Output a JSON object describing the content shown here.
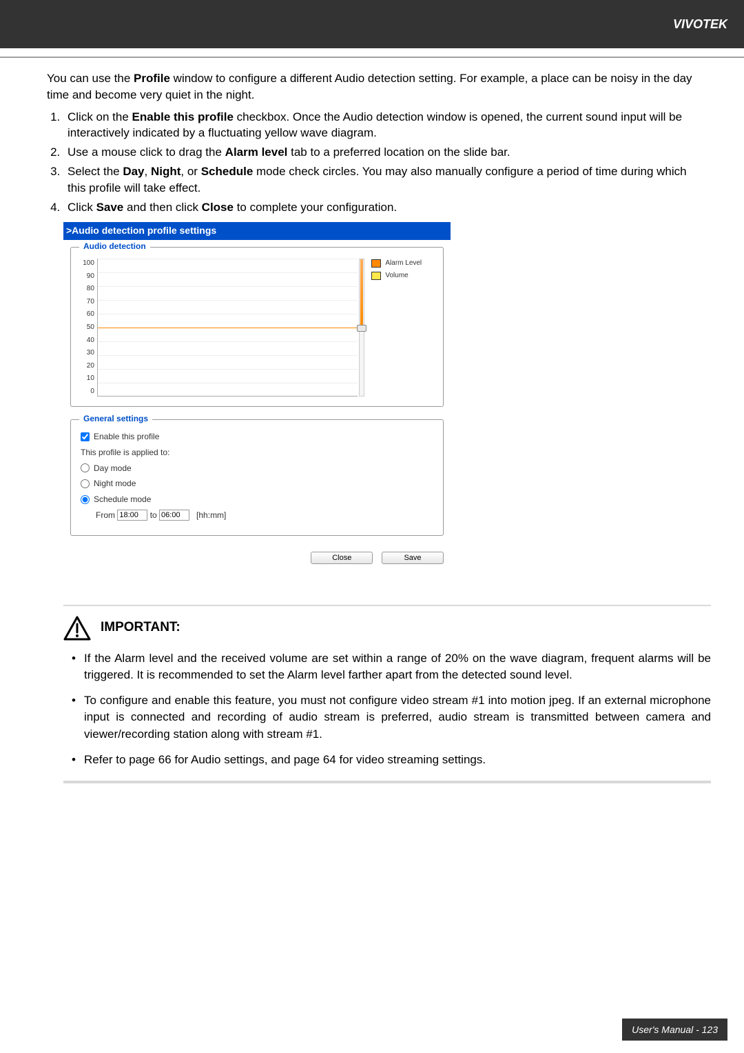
{
  "brand": "VIVOTEK",
  "intro": {
    "p1_a": "You can use the ",
    "p1_b": "Profile",
    "p1_c": " window to configure a different Audio detection setting. For example, a place can be noisy in the day time and become very quiet in the night."
  },
  "steps": [
    {
      "pre": "Click on the ",
      "bold": "Enable this profile",
      "post": " checkbox. Once the Audio detection window is opened, the current sound input will be interactively indicated by a fluctuating yellow wave diagram."
    },
    {
      "pre": "Use a mouse click to drag the ",
      "bold": "Alarm level",
      "post": " tab to a preferred location on the slide bar."
    },
    {
      "pre": "Select the ",
      "bold": "Day",
      "mid1": ", ",
      "bold2": "Night",
      "mid2": ", or ",
      "bold3": "Schedule",
      "post": " mode check circles. You may also manually configure a period of time during which this profile will take effect."
    },
    {
      "pre": "Click ",
      "bold": "Save",
      "mid1": " and then click ",
      "bold2": "Close",
      "post": " to complete your configuration."
    }
  ],
  "panel": {
    "titlebar": ">Audio detection profile settings",
    "legend_audio": "Audio detection",
    "legend_general": "General settings",
    "enable_profile": "Enable this profile",
    "applied_to": "This profile is applied to:",
    "day_mode": "Day mode",
    "night_mode": "Night mode",
    "schedule_mode": "Schedule mode",
    "from_label": "From",
    "to_label": "to",
    "from_value": "18:00",
    "to_value": "06:00",
    "time_unit": "[hh:mm]",
    "close_btn": "Close",
    "save_btn": "Save",
    "legend_alarm": "Alarm Level",
    "legend_volume": "Volume"
  },
  "chart_data": {
    "type": "line",
    "title": "",
    "xlabel": "",
    "ylabel": "",
    "ylim": [
      0,
      100
    ],
    "yticks": [
      100,
      90,
      80,
      70,
      60,
      50,
      40,
      30,
      20,
      10,
      0
    ],
    "series": [
      {
        "name": "Alarm Level",
        "values": [
          50
        ]
      },
      {
        "name": "Volume",
        "values": []
      }
    ]
  },
  "important": {
    "heading": "IMPORTANT:",
    "items": [
      "If the Alarm level and the received volume are set within a range of 20% on the wave diagram, frequent alarms will be triggered. It is recommended to set the Alarm level farther apart from the detected sound level.",
      "To configure and enable this feature, you must not configure video stream #1 into motion jpeg. If an external microphone input is connected and recording of audio stream is preferred, audio stream is transmitted between camera and viewer/recording station along with stream #1.",
      "Refer to page 66 for Audio settings, and page 64 for video streaming settings."
    ]
  },
  "footer": "User's Manual - 123"
}
